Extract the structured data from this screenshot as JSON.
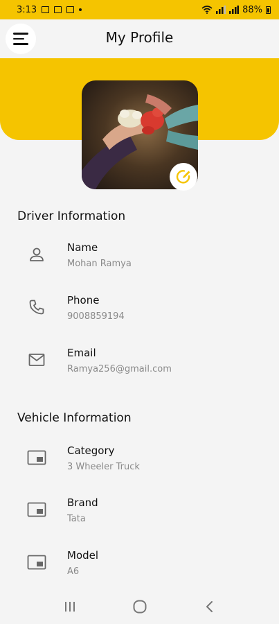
{
  "status_bar": {
    "time": "3:13",
    "battery": "88%"
  },
  "header": {
    "title": "My Profile"
  },
  "driver": {
    "title": "Driver Information",
    "items": [
      {
        "label": "Name",
        "value": "Mohan Ramya",
        "icon": "person-icon"
      },
      {
        "label": "Phone",
        "value": "9008859194",
        "icon": "phone-icon"
      },
      {
        "label": "Email",
        "value": "Ramya256@gmail.com",
        "icon": "mail-icon"
      }
    ]
  },
  "vehicle": {
    "title": "Vehicle Information",
    "items": [
      {
        "label": "Category",
        "value": "3 Wheeler Truck",
        "icon": "vehicle-card-icon"
      },
      {
        "label": "Brand",
        "value": "Tata",
        "icon": "vehicle-card-icon"
      },
      {
        "label": "Model",
        "value": "A6",
        "icon": "vehicle-card-icon"
      }
    ]
  },
  "colors": {
    "accent": "#f5c400",
    "background": "#f4f4f4",
    "icon": "#666666",
    "muted_text": "#8a8a8a"
  }
}
